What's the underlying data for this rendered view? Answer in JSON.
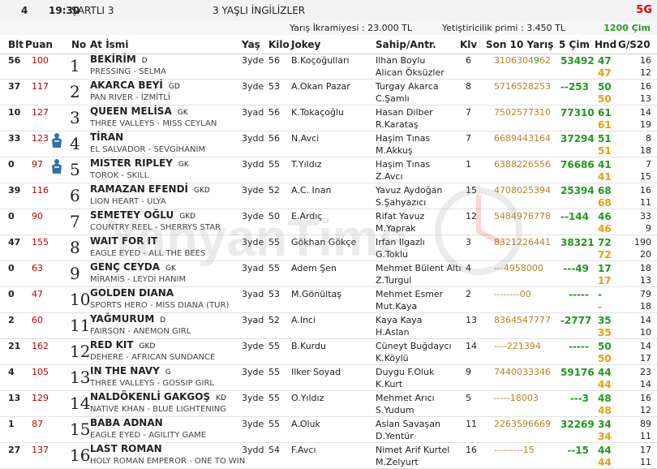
{
  "race": {
    "number": "4",
    "time": "19:30",
    "condition": "ŞARTLI 3",
    "class": "3 YAŞLI İNGİLİZLER",
    "code": "5G",
    "prize": "Yarış İkramiyesi : 23.000 TL",
    "breeder_prize": "Yetiştiricilik primi : 3.450 TL",
    "distance": "1200 Çim"
  },
  "headers": {
    "blt": "Blt",
    "puan": "Puan",
    "no": "No",
    "name": "At İsmi",
    "age": "Yaş",
    "kilo": "Kilo",
    "jokey": "Jokey",
    "sahip": "Sahip/Antr.",
    "klv": "Klv",
    "son10": "Son 10 Yarış",
    "cim": "5 Çim",
    "hnd": "Hnd",
    "gs": "G/S20"
  },
  "watermark": "YanyanTime",
  "colors": {
    "accent": "#e00000",
    "green": "#1f9a1f",
    "orange": "#e8a000",
    "form": "#b8822a"
  },
  "horses": [
    {
      "blt": "56",
      "puan": "100",
      "no": "1",
      "name": "BEKİRİM",
      "tag": "D",
      "ped": "PRESSING - SELMA",
      "age": "3yde",
      "kilo": "56",
      "jokey": "B.Koçoğulları",
      "sahip": "Ilhan Boylu",
      "antr": "Alican Öksüzler",
      "klv": "6",
      "son10": [
        "3106304",
        "9",
        "62"
      ],
      "cim": "53492",
      "h1": "47",
      "h2": "47",
      "g1": "16",
      "g2": "12",
      "silk": false
    },
    {
      "blt": "37",
      "puan": "117",
      "no": "2",
      "name": "AKARCA BEYİ",
      "tag": "GD",
      "ped": "PAN RIVER - İZMİTLİ",
      "age": "3yde",
      "kilo": "53",
      "jokey": "A.Okan Pazar",
      "sahip": "Turgay Akarca",
      "antr": "C.Şamlı",
      "klv": "8",
      "son10": [
        "5716528253",
        "",
        ""
      ],
      "cim": "--253",
      "h1": "50",
      "h2": "50",
      "g1": "16",
      "g2": "13",
      "silk": false
    },
    {
      "blt": "10",
      "puan": "127",
      "no": "3",
      "name": "QUEEN MELİSA",
      "tag": "GK",
      "ped": "THREE VALLEYS - MISS CEYLAN",
      "age": "3yad",
      "kilo": "56",
      "jokey": "K.Tokaçoğlu",
      "sahip": "Hasan Dilber",
      "antr": "R.Karataş",
      "klv": "7",
      "son10": [
        "7502577310",
        "",
        ""
      ],
      "cim": "77310",
      "h1": "61",
      "h2": "61",
      "g1": "14",
      "g2": "19",
      "silk": false
    },
    {
      "blt": "33",
      "puan": "123",
      "no": "4",
      "name": "TİRAN",
      "tag": "",
      "ped": "EL SALVADOR - SEVGİHANIM",
      "age": "3ydd",
      "kilo": "56",
      "jokey": "N.Avci",
      "sahip": "Haşim Tınas",
      "antr": "M.Akkuş",
      "klv": "7",
      "son10": [
        "6689443164",
        "",
        ""
      ],
      "cim": "37294",
      "h1": "51",
      "h2": "51",
      "g1": "8",
      "g2": "18",
      "silk": true
    },
    {
      "blt": "0",
      "puan": "97",
      "no": "5",
      "name": "MISTER RIPLEY",
      "tag": "GK",
      "ped": "TOROK - SKILL",
      "age": "3ydd",
      "kilo": "55",
      "jokey": "T.Yıldız",
      "sahip": "Haşim Tınas",
      "antr": "Z.Avcı",
      "klv": "1",
      "son10": [
        "6388226556",
        "",
        ""
      ],
      "cim": "76686",
      "h1": "41",
      "h2": "41",
      "g1": "7",
      "g2": "15",
      "silk": true
    },
    {
      "blt": "39",
      "puan": "116",
      "no": "6",
      "name": "RAMAZAN EFENDİ",
      "tag": "GKD",
      "ped": "LION HEART - ULYA",
      "age": "3yde",
      "kilo": "52",
      "jokey": "A.C. Inan",
      "sahip": "Yavuz Aydoğan",
      "antr": "S.Şahyazıcı",
      "klv": "15",
      "son10": [
        "4708025394",
        "",
        ""
      ],
      "cim": "25394",
      "h1": "68",
      "h2": "68",
      "g1": "16",
      "g2": "11",
      "silk": false
    },
    {
      "blt": "0",
      "puan": "90",
      "no": "7",
      "name": "SEMETEY OĞLU",
      "tag": "GKD",
      "ped": "COUNTRY REEL - SHERRYS STAR",
      "age": "3yde",
      "kilo": "50",
      "jokey": "E.Ardıç",
      "sahip": "Rifat Yavuz",
      "antr": "M.Yaprak",
      "klv": "12",
      "son10": [
        "5484976778",
        "",
        ""
      ],
      "cim": "--144",
      "h1": "46",
      "h2": "46",
      "g1": "33",
      "g2": "9",
      "silk": false
    },
    {
      "blt": "47",
      "puan": "155",
      "no": "8",
      "name": "WAIT FOR IT",
      "tag": "",
      "ped": "EAGLE EYED - ALL THE BEES",
      "age": "3yde",
      "kilo": "55",
      "jokey": "Gökhan Gökçe",
      "sahip": "Irfan Ilgazlı",
      "antr": "G.Toklu",
      "klv": "3",
      "son10": [
        "8321226441",
        "",
        ""
      ],
      "cim": "38321",
      "h1": "72",
      "h2": "72",
      "g1": "190",
      "g2": "20",
      "silk": false
    },
    {
      "blt": "0",
      "puan": "63",
      "no": "9",
      "name": "GENÇ CEYDA",
      "tag": "GK",
      "ped": "MİRAMİS - LEYDİ HANIM",
      "age": "3yad",
      "kilo": "55",
      "jokey": "Adem Şen",
      "sahip": "Mehmet Bülent Altı",
      "antr": "Z.Turgul",
      "klv": "4",
      "son10": [
        "---4958000",
        "",
        ""
      ],
      "cim": "---49",
      "h1": "17",
      "h2": "17",
      "g1": "18",
      "g2": "13",
      "silk": false
    },
    {
      "blt": "0",
      "puan": "47",
      "no": "10",
      "name": "GOLDEN DIANA",
      "tag": "",
      "ped": "SPORTS HERO - MISS DIANA (TUR)",
      "age": "3yad",
      "kilo": "53",
      "jokey": "M.Gönültaş",
      "sahip": "Mehmet Esmer",
      "antr": "Mut.Kaya",
      "klv": "2",
      "son10": [
        "--------00",
        "",
        ""
      ],
      "cim": "-----",
      "h1": "-",
      "h2": "-",
      "g1": "79",
      "g2": "18",
      "silk": false
    },
    {
      "blt": "2",
      "puan": "60",
      "no": "11",
      "name": "YAĞMURUM",
      "tag": "D",
      "ped": "FAIRSON - ANEMON GIRL",
      "age": "3yad",
      "kilo": "52",
      "jokey": "A.Inci",
      "sahip": "Kaya Kaya",
      "antr": "H.Aslan",
      "klv": "13",
      "son10": [
        "8364547777",
        "",
        ""
      ],
      "cim": "-2777",
      "h1": "35",
      "h2": "35",
      "g1": "14",
      "g2": "10",
      "silk": false
    },
    {
      "blt": "21",
      "puan": "162",
      "no": "12",
      "name": "RED KIT",
      "tag": "GKD",
      "ped": "DEHERE - AFRICAN SUNDANCE",
      "age": "3yde",
      "kilo": "55",
      "jokey": "B.Kurdu",
      "sahip": "Cüneyt Buğdaycı",
      "antr": "K.Köylü",
      "klv": "14",
      "son10": [
        "----221394",
        "",
        ""
      ],
      "cim": "-----",
      "h1": "50",
      "h2": "50",
      "g1": "14",
      "g2": "17",
      "silk": false
    },
    {
      "blt": "4",
      "puan": "105",
      "no": "13",
      "name": "IN THE NAVY",
      "tag": "G",
      "ped": "THREE VALLEYS - GOSSIP GIRL",
      "age": "3yde",
      "kilo": "55",
      "jokey": "Ilker Soyad",
      "sahip": "Duygu F.Oluk",
      "antr": "K.Kurt",
      "klv": "9",
      "son10": [
        "7440033346",
        "",
        ""
      ],
      "cim": "59176",
      "h1": "44",
      "h2": "44",
      "g1": "23",
      "g2": "14",
      "silk": false
    },
    {
      "blt": "13",
      "puan": "129",
      "no": "14",
      "name": "NALDÖKENLİ GAKGOŞ",
      "tag": "KD",
      "ped": "NATIVE KHAN - BLUE LIGHTENING",
      "age": "3yde",
      "kilo": "55",
      "jokey": "O.Yıldız",
      "sahip": "Mehmet Arıcı",
      "antr": "S.Yudum",
      "klv": "5",
      "son10": [
        "-----18003",
        "",
        ""
      ],
      "cim": "---3",
      "h1": "48",
      "h2": "48",
      "g1": "16",
      "g2": "12",
      "silk": false
    },
    {
      "blt": "1",
      "puan": "87",
      "no": "15",
      "name": "BABA ADNAN",
      "tag": "",
      "ped": "EAGLE EYED - AGILITY GAME",
      "age": "3yde",
      "kilo": "55",
      "jokey": "A.Oluk",
      "sahip": "Aslan Savaşan",
      "antr": "D.Yentür",
      "klv": "11",
      "son10": [
        "2263596669",
        "",
        ""
      ],
      "cim": "32269",
      "h1": "34",
      "h2": "34",
      "g1": "89",
      "g2": "11",
      "silk": false
    },
    {
      "blt": "27",
      "puan": "137",
      "no": "16",
      "name": "LAST ROMAN",
      "tag": "",
      "ped": "HOLY ROMAN EMPEROR - ONE TO WIN",
      "age": "3ydd",
      "kilo": "54",
      "jokey": "F.Avcı",
      "sahip": "Nimet Arif Kurtel",
      "antr": "M.Zelyurt",
      "klv": "16",
      "son10": [
        "---------15",
        "",
        ""
      ],
      "cim": "--15",
      "h1": "44",
      "h2": "44",
      "g1": "17",
      "g2": "11",
      "silk": false
    }
  ]
}
